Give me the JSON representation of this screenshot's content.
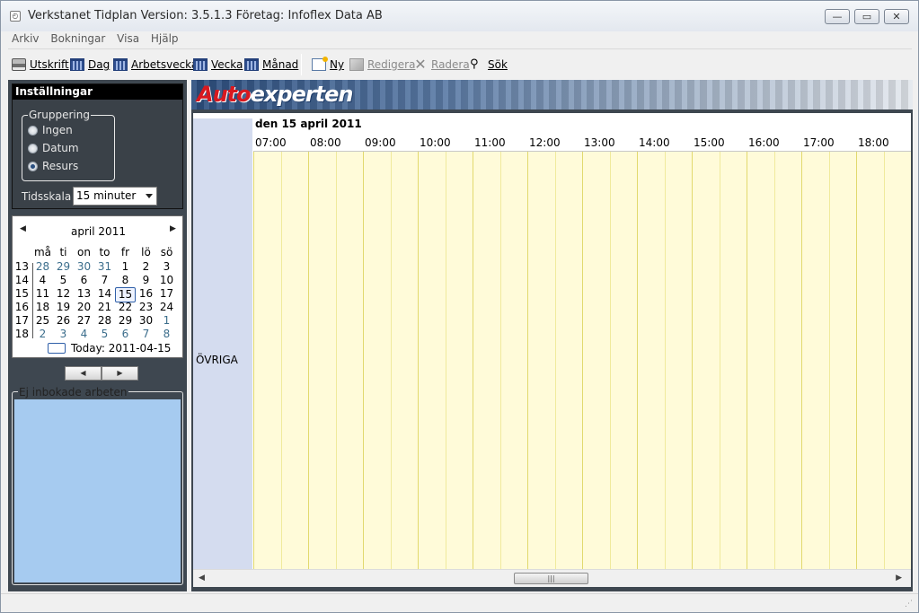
{
  "window": {
    "title": "Verkstanet Tidplan Version: 3.5.1.3  Företag: Infoflex Data AB",
    "minimize": "—",
    "maximize": "▭",
    "close": "✕"
  },
  "menu": [
    "Arkiv",
    "Bokningar",
    "Visa",
    "Hjälp"
  ],
  "toolbar": {
    "print": {
      "label": "Utskrift",
      "icon": "printer-icon"
    },
    "day": {
      "label": "Dag",
      "icon": "calendar-icon"
    },
    "workweek": {
      "label": "Arbetsvecka",
      "icon": "calendar-icon"
    },
    "week": {
      "label": "Vecka",
      "icon": "calendar-icon"
    },
    "month": {
      "label": "Månad",
      "icon": "calendar-icon"
    },
    "new": {
      "label": "Ny",
      "icon": "new-document-icon"
    },
    "edit": {
      "label": "Redigera",
      "icon": "edit-icon"
    },
    "delete": {
      "label": "Radera",
      "icon": "delete-icon"
    },
    "search": {
      "label": "Sök",
      "icon": "binoculars-icon"
    }
  },
  "settings": {
    "header": "Inställningar",
    "grouping_label": "Gruppering",
    "options": [
      "Ingen",
      "Datum",
      "Resurs"
    ],
    "selected_option": "Resurs",
    "timescale_label": "Tidsskala",
    "timescale_value": "15 minuter"
  },
  "calendar": {
    "month_title": "april 2011",
    "prev": "◀",
    "next": "▶",
    "weekdays": [
      "må",
      "ti",
      "on",
      "to",
      "fr",
      "lö",
      "sö"
    ],
    "weeks": [
      {
        "wk": "13",
        "days": [
          "28",
          "29",
          "30",
          "31",
          "1",
          "2",
          "3"
        ],
        "other": [
          0,
          1,
          2,
          3
        ]
      },
      {
        "wk": "14",
        "days": [
          "4",
          "5",
          "6",
          "7",
          "8",
          "9",
          "10"
        ],
        "other": []
      },
      {
        "wk": "15",
        "days": [
          "11",
          "12",
          "13",
          "14",
          "15",
          "16",
          "17"
        ],
        "other": []
      },
      {
        "wk": "16",
        "days": [
          "18",
          "19",
          "20",
          "21",
          "22",
          "23",
          "24"
        ],
        "other": []
      },
      {
        "wk": "17",
        "days": [
          "25",
          "26",
          "27",
          "28",
          "29",
          "30",
          "1"
        ],
        "other": [
          6
        ]
      },
      {
        "wk": "18",
        "days": [
          "2",
          "3",
          "4",
          "5",
          "6",
          "7",
          "8"
        ],
        "other": [
          0,
          1,
          2,
          3,
          4,
          5,
          6
        ]
      }
    ],
    "selected_day": "15",
    "today_label": "Today: 2011-04-15"
  },
  "pager": {
    "prev": "◀",
    "next": "▶"
  },
  "unbooked": {
    "label": "Ej inbokade arbeten"
  },
  "banner": {
    "logo_part1": "Auto",
    "logo_part2": "experten"
  },
  "schedule": {
    "date_header": "den 15 april 2011",
    "hours": [
      "07:00",
      "08:00",
      "09:00",
      "10:00",
      "11:00",
      "12:00",
      "13:00",
      "14:00",
      "15:00",
      "16:00",
      "17:00",
      "18:00"
    ],
    "resource": "ÖVRIGA",
    "scroll_left": "◀",
    "scroll_right": "▶",
    "scroll_grip": "|||"
  },
  "statusbar": {
    "grip": "⋰"
  }
}
